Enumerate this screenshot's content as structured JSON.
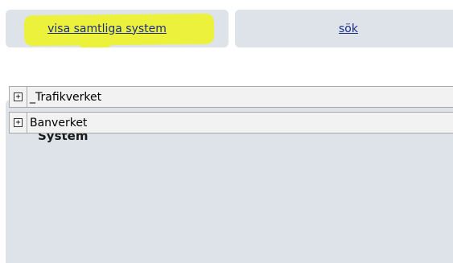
{
  "tabs": [
    {
      "label": "visa samtliga system",
      "highlighted": true
    },
    {
      "label": "sök",
      "highlighted": false
    }
  ],
  "panel": {
    "title": "System",
    "tree_items": [
      {
        "label": "_Trafikverket",
        "expander_icon": "plus-box-icon",
        "expander_glyph": "+"
      },
      {
        "label": "Banverket",
        "expander_icon": "plus-box-icon",
        "expander_glyph": "+"
      }
    ]
  },
  "colors": {
    "tab_background": "#dde3e9",
    "link": "#1d2f84",
    "highlight": "#ecf23b",
    "row_background": "#f2f2f2",
    "row_border": "#a7a9ab"
  }
}
